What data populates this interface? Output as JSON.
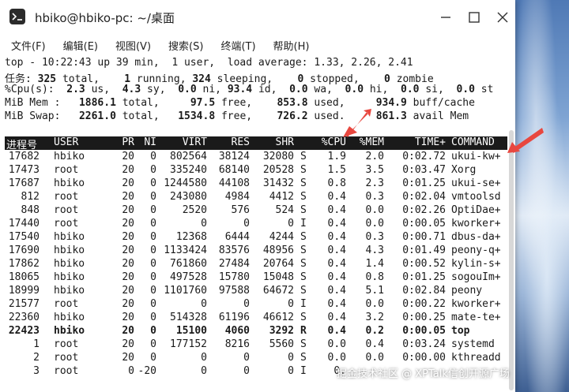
{
  "window": {
    "title": "hbiko@hbiko-pc: ~/桌面"
  },
  "menu": [
    {
      "label": "文件(F)"
    },
    {
      "label": "编辑(E)"
    },
    {
      "label": "视图(V)"
    },
    {
      "label": "搜索(S)"
    },
    {
      "label": "终端(T)"
    },
    {
      "label": "帮助(H)"
    }
  ],
  "summary": {
    "line1": "top - 10:22:43 up 39 min,  1 user,  load average: 1.33, 2.26, 2.41",
    "tasks": {
      "label": "任务:",
      "total": "325",
      "total_label": "total,",
      "running": "1",
      "running_label": "running,",
      "sleeping": "324",
      "sleeping_label": "sleeping,",
      "stopped": "0",
      "stopped_label": "stopped,",
      "zombie": "0",
      "zombie_label": "zombie"
    },
    "cpu": {
      "label": "%Cpu(s):",
      "us": "2.3",
      "us_label": "us,",
      "sy": "4.3",
      "sy_label": "sy,",
      "ni": "0.0",
      "ni_label": "ni,",
      "id": "93.4",
      "id_label": "id,",
      "wa": "0.0",
      "wa_label": "wa,",
      "hi": "0.0",
      "hi_label": "hi,",
      "si": "0.0",
      "si_label": "si,",
      "st": "0.0",
      "st_label": "st"
    },
    "mem": {
      "label": "MiB Mem :",
      "total": "1886.1",
      "total_label": "total,",
      "free": "97.5",
      "free_label": "free,",
      "used": "853.8",
      "used_label": "used,",
      "buff": "934.9",
      "buff_label": "buff/cache"
    },
    "swap": {
      "label": "MiB Swap:",
      "total": "2261.0",
      "total_label": "total,",
      "free": "1534.8",
      "free_label": "free,",
      "used": "726.2",
      "used_label": "used.",
      "avail": "861.3",
      "avail_label": "avail Mem"
    }
  },
  "columns": [
    "进程号",
    "USER",
    "PR",
    "NI",
    "VIRT",
    "RES",
    "SHR",
    "",
    "%CPU",
    "%MEM",
    "TIME+",
    "COMMAND"
  ],
  "processes": [
    {
      "pid": "17682",
      "user": "hbiko",
      "pr": "20",
      "ni": "0",
      "virt": "802564",
      "res": "38124",
      "shr": "32080",
      "s": "S",
      "cpu": "1.9",
      "mem": "2.0",
      "time": "0:02.72",
      "cmd": "ukui-kw+"
    },
    {
      "pid": "17473",
      "user": "root",
      "pr": "20",
      "ni": "0",
      "virt": "335240",
      "res": "68140",
      "shr": "20528",
      "s": "S",
      "cpu": "1.5",
      "mem": "3.5",
      "time": "0:03.47",
      "cmd": "Xorg"
    },
    {
      "pid": "17687",
      "user": "hbiko",
      "pr": "20",
      "ni": "0",
      "virt": "1244580",
      "res": "44108",
      "shr": "31432",
      "s": "S",
      "cpu": "0.8",
      "mem": "2.3",
      "time": "0:01.25",
      "cmd": "ukui-se+"
    },
    {
      "pid": "812",
      "user": "root",
      "pr": "20",
      "ni": "0",
      "virt": "243080",
      "res": "4984",
      "shr": "4412",
      "s": "S",
      "cpu": "0.4",
      "mem": "0.3",
      "time": "0:02.04",
      "cmd": "vmtoolsd"
    },
    {
      "pid": "848",
      "user": "root",
      "pr": "20",
      "ni": "0",
      "virt": "2520",
      "res": "576",
      "shr": "524",
      "s": "S",
      "cpu": "0.4",
      "mem": "0.0",
      "time": "0:02.26",
      "cmd": "OptiDae+"
    },
    {
      "pid": "17440",
      "user": "root",
      "pr": "20",
      "ni": "0",
      "virt": "0",
      "res": "0",
      "shr": "0",
      "s": "I",
      "cpu": "0.4",
      "mem": "0.0",
      "time": "0:00.05",
      "cmd": "kworker+"
    },
    {
      "pid": "17540",
      "user": "hbiko",
      "pr": "20",
      "ni": "0",
      "virt": "12368",
      "res": "6444",
      "shr": "4244",
      "s": "S",
      "cpu": "0.4",
      "mem": "0.3",
      "time": "0:00.71",
      "cmd": "dbus-da+"
    },
    {
      "pid": "17690",
      "user": "hbiko",
      "pr": "20",
      "ni": "0",
      "virt": "1133424",
      "res": "83576",
      "shr": "48956",
      "s": "S",
      "cpu": "0.4",
      "mem": "4.3",
      "time": "0:01.49",
      "cmd": "peony-q+"
    },
    {
      "pid": "17862",
      "user": "hbiko",
      "pr": "20",
      "ni": "0",
      "virt": "761860",
      "res": "27484",
      "shr": "20764",
      "s": "S",
      "cpu": "0.4",
      "mem": "1.4",
      "time": "0:00.52",
      "cmd": "kylin-s+"
    },
    {
      "pid": "18065",
      "user": "hbiko",
      "pr": "20",
      "ni": "0",
      "virt": "497528",
      "res": "15780",
      "shr": "15048",
      "s": "S",
      "cpu": "0.4",
      "mem": "0.8",
      "time": "0:01.25",
      "cmd": "sogouIm+"
    },
    {
      "pid": "18999",
      "user": "hbiko",
      "pr": "20",
      "ni": "0",
      "virt": "1101760",
      "res": "97588",
      "shr": "64672",
      "s": "S",
      "cpu": "0.4",
      "mem": "5.1",
      "time": "0:02.84",
      "cmd": "peony"
    },
    {
      "pid": "21577",
      "user": "root",
      "pr": "20",
      "ni": "0",
      "virt": "0",
      "res": "0",
      "shr": "0",
      "s": "I",
      "cpu": "0.4",
      "mem": "0.0",
      "time": "0:00.22",
      "cmd": "kworker+"
    },
    {
      "pid": "22360",
      "user": "hbiko",
      "pr": "20",
      "ni": "0",
      "virt": "514328",
      "res": "61196",
      "shr": "46612",
      "s": "S",
      "cpu": "0.4",
      "mem": "3.2",
      "time": "0:00.25",
      "cmd": "mate-te+"
    },
    {
      "pid": "22423",
      "user": "hbiko",
      "pr": "20",
      "ni": "0",
      "virt": "15100",
      "res": "4060",
      "shr": "3292",
      "s": "R",
      "cpu": "0.4",
      "mem": "0.2",
      "time": "0:00.05",
      "cmd": "top",
      "bold": true
    },
    {
      "pid": "1",
      "user": "root",
      "pr": "20",
      "ni": "0",
      "virt": "177152",
      "res": "8216",
      "shr": "5560",
      "s": "S",
      "cpu": "0.0",
      "mem": "0.4",
      "time": "0:03.24",
      "cmd": "systemd"
    },
    {
      "pid": "2",
      "user": "root",
      "pr": "20",
      "ni": "0",
      "virt": "0",
      "res": "0",
      "shr": "0",
      "s": "S",
      "cpu": "0.0",
      "mem": "0.0",
      "time": "0:00.00",
      "cmd": "kthreadd"
    },
    {
      "pid": "3",
      "user": "root",
      "pr": "0",
      "ni": "-20",
      "virt": "0",
      "res": "0",
      "shr": "0",
      "s": "I",
      "cpu": "0.",
      "mem": "",
      "time": "",
      "cmd": ""
    }
  ],
  "watermark": "掘金技术社区 @ XPTalk信创开源广场",
  "colors": {
    "header_bg": "#1a1a1a",
    "header_fg": "#ffffff",
    "arrow": "#e8473f"
  }
}
